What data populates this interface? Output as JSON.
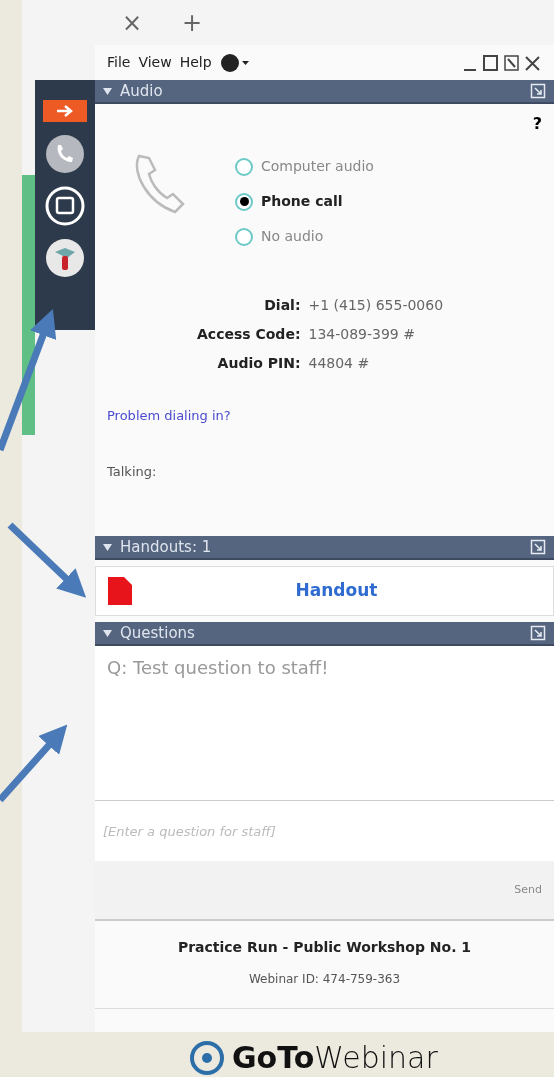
{
  "browser_tab": {
    "close": "×",
    "new_tab": "+"
  },
  "menu": [
    "File",
    "View",
    "Help"
  ],
  "audio": {
    "title": "Audio",
    "help": "?",
    "options": [
      {
        "label": "Computer audio",
        "selected": false
      },
      {
        "label": "Phone call",
        "selected": true
      },
      {
        "label": "No audio",
        "selected": false
      }
    ],
    "dial_info": [
      {
        "label": "Dial:",
        "value": "+1 (415) 655-0060"
      },
      {
        "label": "Access Code:",
        "value": "134-089-399 #"
      },
      {
        "label": "Audio PIN:",
        "value": "44804 #"
      }
    ],
    "link": "Problem dialing in?",
    "talking": "Talking:"
  },
  "handouts": {
    "title": "Handouts: 1",
    "items": [
      "Handout"
    ]
  },
  "questions": {
    "title": "Questions",
    "items": [
      "Q: Test question to staff!"
    ],
    "placeholder": "[Enter a question for staff]",
    "send": "Send"
  },
  "footer": {
    "title": "Practice Run - Public Workshop No. 1",
    "webinar_id": "Webinar ID: 474-759-363",
    "logo_bold": "GoTo",
    "logo_light": "Webinar"
  }
}
